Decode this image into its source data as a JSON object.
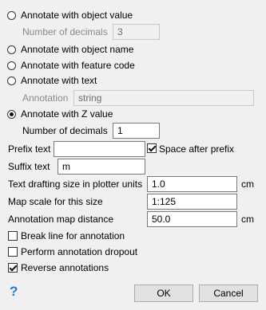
{
  "options": {
    "object_value": "Annotate with object value",
    "decimals_label_1": "Number of decimals",
    "decimals_value_1": "3",
    "object_name": "Annotate with object name",
    "feature_code": "Annotate with feature code",
    "text": "Annotate with text",
    "annotation_label": "Annotation",
    "annotation_value": "string",
    "z_value": "Annotate with Z value",
    "decimals_label_2": "Number of decimals",
    "decimals_value_2": "1"
  },
  "prefix": {
    "label": "Prefix text",
    "value": "",
    "space_after_label": "Space after prefix",
    "space_after_checked": true
  },
  "suffix": {
    "label": "Suffix text",
    "value": "m"
  },
  "drafting": {
    "label": "Text drafting size in plotter units",
    "value": "1.0",
    "unit": "cm"
  },
  "map_scale": {
    "label": "Map scale for this size",
    "value": "1:125"
  },
  "distance": {
    "label": "Annotation map distance",
    "value": "50.0",
    "unit": "cm"
  },
  "checks": {
    "break_line": "Break line for annotation",
    "dropout": "Perform annotation dropout",
    "reverse": "Reverse annotations"
  },
  "buttons": {
    "help": "?",
    "ok": "OK",
    "cancel": "Cancel"
  }
}
